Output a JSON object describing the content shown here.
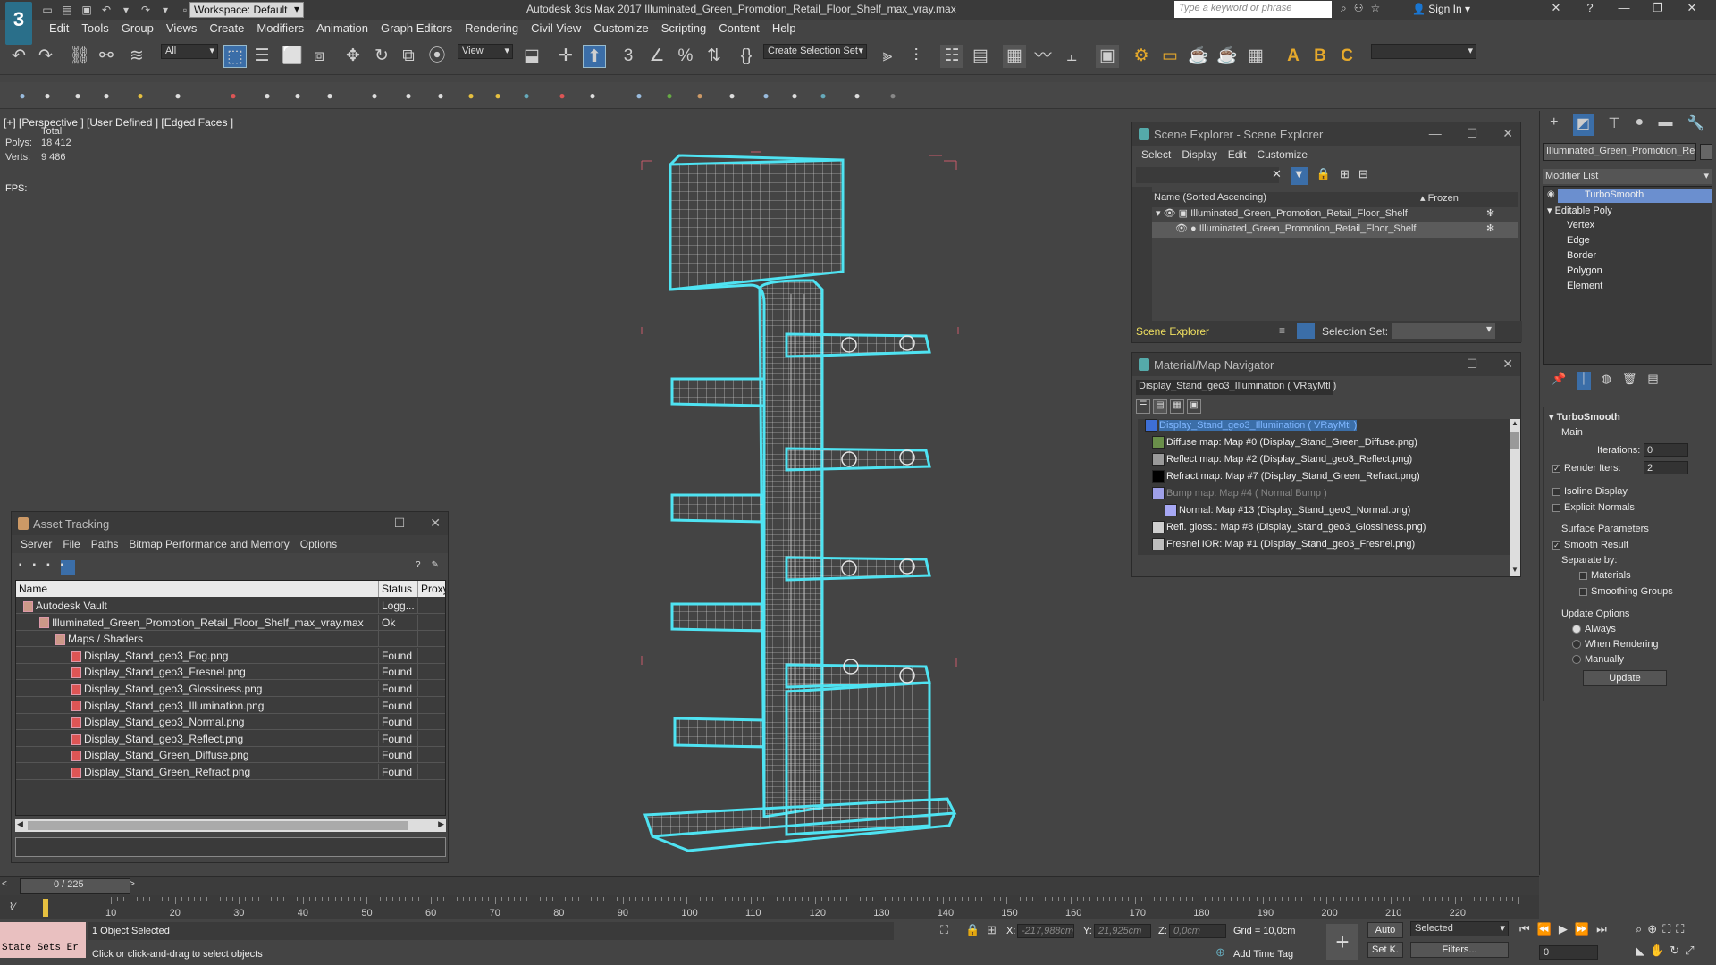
{
  "app": {
    "logo": "3",
    "title": "Autodesk 3ds Max 2017     Illuminated_Green_Promotion_Retail_Floor_Shelf_max_vray.max",
    "workspace": "Workspace: Default",
    "search_placeholder": "Type a keyword or phrase",
    "sign_in": "Sign In"
  },
  "menu": [
    "Edit",
    "Tools",
    "Group",
    "Views",
    "Create",
    "Modifiers",
    "Animation",
    "Graph Editors",
    "Rendering",
    "Civil View",
    "Customize",
    "Scripting",
    "Content",
    "Help"
  ],
  "toolbar": {
    "filter": "All",
    "view": "View",
    "selection_set": "Create Selection Set"
  },
  "viewport": {
    "label": "[+] [Perspective ]  [User Defined ]  [Edged Faces ]",
    "stats_total": "Total",
    "polys_label": "Polys:",
    "polys_value": "18 412",
    "verts_label": "Verts:",
    "verts_value": "9 486",
    "fps_label": "FPS:"
  },
  "scene_explorer": {
    "title": "Scene Explorer - Scene Explorer",
    "menu": [
      "Select",
      "Display",
      "Edit",
      "Customize"
    ],
    "col_name": "Name (Sorted Ascending)",
    "col_frozen": "▴ Frozen",
    "rows": [
      "Illuminated_Green_Promotion_Retail_Floor_Shelf",
      "Illuminated_Green_Promotion_Retail_Floor_Shelf"
    ],
    "footer_label": "Scene Explorer",
    "selection_set": "Selection Set:"
  },
  "material_navigator": {
    "title": "Material/Map Navigator",
    "current": "Display_Stand_geo3_Illumination  ( VRayMtl )",
    "rows": [
      {
        "text": "Display_Stand_geo3_Illumination  ( VRayMtl )",
        "color": "#3e6fd6",
        "dim": false,
        "sel": true
      },
      {
        "text": "Diffuse map: Map #0 (Display_Stand_Green_Diffuse.png)",
        "color": "#6a8f4a",
        "dim": false
      },
      {
        "text": "Reflect map: Map #2 (Display_Stand_geo3_Reflect.png)",
        "color": "#9a9a9a",
        "dim": false
      },
      {
        "text": "Refract map: Map #7 (Display_Stand_Green_Refract.png)",
        "color": "#000000",
        "dim": false
      },
      {
        "text": "Bump map: Map #4  ( Normal Bump )",
        "color": "#9fa0e8",
        "dim": true
      },
      {
        "text": "Normal: Map #13 (Display_Stand_geo3_Normal.png)",
        "color": "#a7a8f5",
        "dim": false
      },
      {
        "text": "Refl. gloss.: Map #8 (Display_Stand_geo3_Glossiness.png)",
        "color": "#cfcfcf",
        "dim": false
      },
      {
        "text": "Fresnel IOR: Map #1 (Display_Stand_geo3_Fresnel.png)",
        "color": "#bdbdbd",
        "dim": false
      }
    ]
  },
  "asset_tracking": {
    "title": "Asset Tracking",
    "menu": [
      "Server",
      "File",
      "Paths",
      "Bitmap Performance and Memory",
      "Options"
    ],
    "columns": [
      "Name",
      "Status",
      "Proxy..."
    ],
    "rows": [
      {
        "name": "Autodesk Vault",
        "status": "Logg..."
      },
      {
        "name": "Illuminated_Green_Promotion_Retail_Floor_Shelf_max_vray.max",
        "status": "Ok"
      },
      {
        "name": "Maps / Shaders",
        "status": ""
      },
      {
        "name": "Display_Stand_geo3_Fog.png",
        "status": "Found"
      },
      {
        "name": "Display_Stand_geo3_Fresnel.png",
        "status": "Found"
      },
      {
        "name": "Display_Stand_geo3_Glossiness.png",
        "status": "Found"
      },
      {
        "name": "Display_Stand_geo3_Illumination.png",
        "status": "Found"
      },
      {
        "name": "Display_Stand_geo3_Normal.png",
        "status": "Found"
      },
      {
        "name": "Display_Stand_geo3_Reflect.png",
        "status": "Found"
      },
      {
        "name": "Display_Stand_Green_Diffuse.png",
        "status": "Found"
      },
      {
        "name": "Display_Stand_Green_Refract.png",
        "status": "Found"
      }
    ]
  },
  "command_panel": {
    "object_name": "Illuminated_Green_Promotion_Retai",
    "modifier_list": "Modifier List",
    "stack": [
      "TurboSmooth",
      "Editable Poly",
      "Vertex",
      "Edge",
      "Border",
      "Polygon",
      "Element"
    ],
    "rollout_title": "TurboSmooth",
    "main": "Main",
    "iterations_label": "Iterations:",
    "iterations_value": "0",
    "render_iters_label": "Render Iters:",
    "render_iters_value": "2",
    "isoline": "Isoline Display",
    "explicit_normals": "Explicit Normals",
    "surface_params": "Surface Parameters",
    "smooth_result": "Smooth Result",
    "separate_by": "Separate by:",
    "materials": "Materials",
    "smoothing_groups": "Smoothing Groups",
    "update_options": "Update Options",
    "always": "Always",
    "when_rendering": "When Rendering",
    "manually": "Manually",
    "update_btn": "Update"
  },
  "timeline": {
    "position": "0 / 225",
    "ticks": [
      "10",
      "20",
      "30",
      "40",
      "50",
      "60",
      "70",
      "80",
      "90",
      "100",
      "110",
      "120",
      "130",
      "140",
      "150",
      "160",
      "170",
      "180",
      "190",
      "200",
      "210",
      "220"
    ]
  },
  "status": {
    "state_sets": "State Sets Er",
    "selected": "1 Object Selected",
    "hint": "Click or click-and-drag to select objects",
    "x_label": "X:",
    "x_value": "-217,988cm",
    "y_label": "Y:",
    "y_value": "21,925cm",
    "z_label": "Z:",
    "z_value": "0,0cm",
    "grid": "Grid = 10,0cm",
    "add_time_tag": "Add Time Tag",
    "auto": "Auto",
    "set_k": "Set K.",
    "selected_dd": "Selected",
    "filters": "Filters...",
    "frame": "0"
  }
}
